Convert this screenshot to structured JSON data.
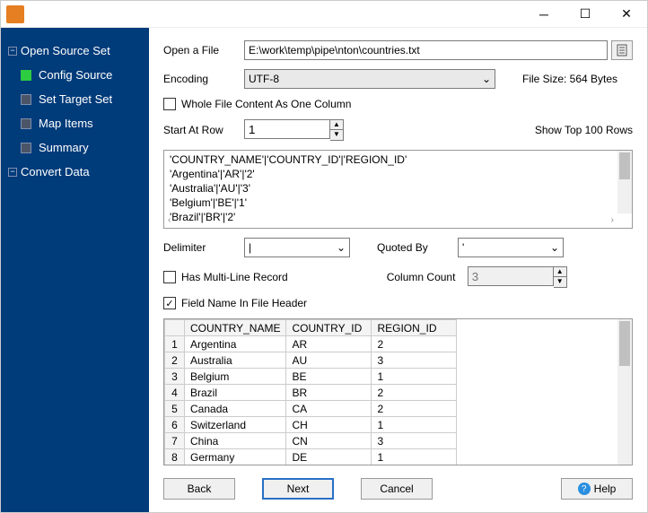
{
  "sidebar": {
    "root": "Open Source Set",
    "children": [
      "Config Source",
      "Set Target Set",
      "Map Items",
      "Summary"
    ],
    "last": "Convert Data",
    "active_index": 0
  },
  "form": {
    "open_file_label": "Open a File",
    "file_path": "E:\\work\\temp\\pipe\\nton\\countries.txt",
    "encoding_label": "Encoding",
    "encoding_value": "UTF-8",
    "file_size_label": "File Size: 564 Bytes",
    "whole_file_label": "Whole File Content As One Column",
    "start_row_label": "Start At Row",
    "start_row_value": "1",
    "show_top_label": "Show Top 100 Rows",
    "delimiter_label": "Delimiter",
    "delimiter_value": "|",
    "quoted_label": "Quoted By",
    "quoted_value": "'",
    "multiline_label": "Has Multi-Line Record",
    "colcount_label": "Column Count",
    "colcount_value": "3",
    "fieldname_label": "Field Name In File Header"
  },
  "preview_lines": [
    "'COUNTRY_NAME'|'COUNTRY_ID'|'REGION_ID'",
    "'Argentina'|'AR'|'2'",
    "'Australia'|'AU'|'3'",
    "'Belgium'|'BE'|'1'",
    "'Brazil'|'BR'|'2'"
  ],
  "table": {
    "headers": [
      "COUNTRY_NAME",
      "COUNTRY_ID",
      "REGION_ID"
    ],
    "rows": [
      [
        "Argentina",
        "AR",
        "2"
      ],
      [
        "Australia",
        "AU",
        "3"
      ],
      [
        "Belgium",
        "BE",
        "1"
      ],
      [
        "Brazil",
        "BR",
        "2"
      ],
      [
        "Canada",
        "CA",
        "2"
      ],
      [
        "Switzerland",
        "CH",
        "1"
      ],
      [
        "China",
        "CN",
        "3"
      ],
      [
        "Germany",
        "DE",
        "1"
      ]
    ]
  },
  "buttons": {
    "back": "Back",
    "next": "Next",
    "cancel": "Cancel",
    "help": "Help"
  }
}
